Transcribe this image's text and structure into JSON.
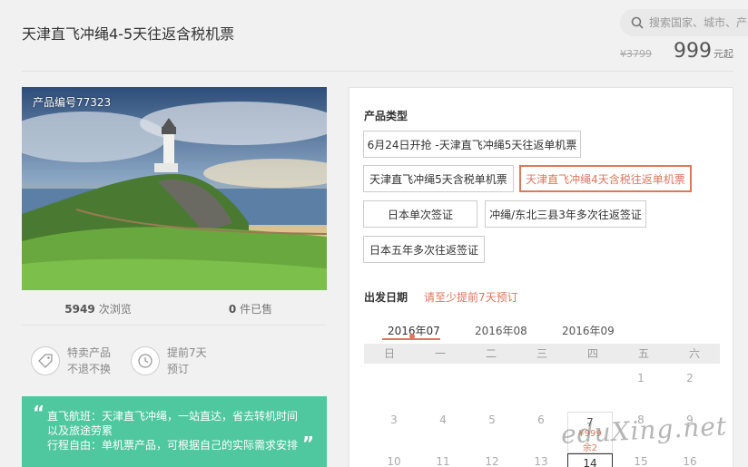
{
  "title": "天津直飞冲绳4-5天往返含税机票",
  "search": {
    "placeholder": "搜索国家、城市、产品"
  },
  "price": {
    "original": "¥3799",
    "current": "999",
    "unit": "元起"
  },
  "photo": {
    "code": "产品编号77323"
  },
  "stats": {
    "views_num": "5949",
    "views_label": "次浏览",
    "sold_num": "0",
    "sold_label": "件已售"
  },
  "features": [
    {
      "icon": "tag-icon",
      "line1": "特卖产品",
      "line2": "不退不换"
    },
    {
      "icon": "clock-icon",
      "line1": "提前7天",
      "line2": "预订"
    }
  ],
  "note": {
    "line1": "直飞航班：天津直飞冲绳，一站直达，省去转机时间",
    "line2": "以及旅途劳累",
    "line3": "行程自由：单机票产品，可根据自己的实际需求安排"
  },
  "product_type": {
    "label": "产品类型",
    "options": [
      "6月24日开抢 -天津直飞冲绳5天往返单机票",
      "天津直飞冲绳5天含税单机票",
      "天津直飞冲绳4天含税往返单机票",
      "日本单次签证",
      "冲绳/东北三县3年多次往返签证",
      "日本五年多次往返签证"
    ],
    "selected": "天津直飞冲绳4天含税往返单机票"
  },
  "departure": {
    "label": "出发日期",
    "hint": "请至少提前7天预订"
  },
  "months": [
    "2016年07",
    "2016年08",
    "2016年09"
  ],
  "weekdays": [
    "日",
    "一",
    "二",
    "三",
    "四",
    "五",
    "六"
  ],
  "calendar": {
    "row1": [
      "1",
      "2"
    ],
    "row2": [
      "3",
      "4",
      "5",
      "6",
      "7",
      "8",
      "9"
    ],
    "row3": [
      "10",
      "11",
      "12",
      "13",
      "14",
      "15",
      "16"
    ],
    "selected_price": "¥999",
    "selected_remain": "余2"
  },
  "watermark": "eduXing.net",
  "colors": {
    "accent": "#e0765c",
    "note_bg": "#4fc79f"
  }
}
